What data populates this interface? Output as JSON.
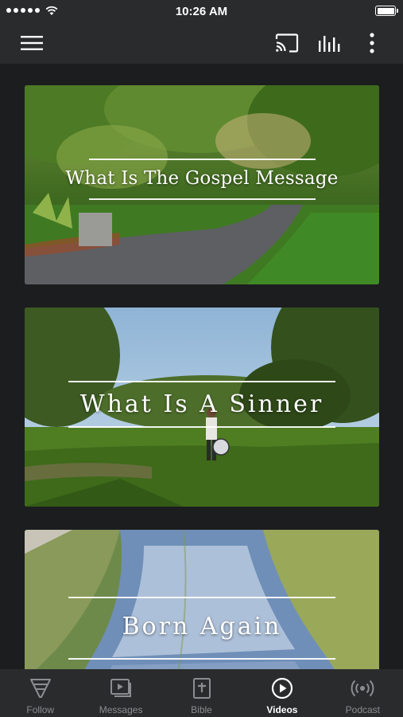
{
  "status_bar": {
    "time": "10:26 AM"
  },
  "app_bar": {
    "icons": [
      "menu-icon",
      "cast-icon",
      "equalizer-icon",
      "more-vertical-icon"
    ]
  },
  "videos": [
    {
      "title": "What Is The Gospel Message",
      "thumbnail": "park-path-trees"
    },
    {
      "title": "What Is A Sinner",
      "thumbnail": "person-walking-in-park"
    },
    {
      "title": "Born Again",
      "thumbnail": "aerial-canal-reeds"
    }
  ],
  "tabs": [
    {
      "label": "Follow",
      "icon": "follow-icon",
      "active": false
    },
    {
      "label": "Messages",
      "icon": "messages-icon",
      "active": false
    },
    {
      "label": "Bible",
      "icon": "bible-icon",
      "active": false
    },
    {
      "label": "Videos",
      "icon": "play-circle-icon",
      "active": true
    },
    {
      "label": "Podcast",
      "icon": "podcast-icon",
      "active": false
    }
  ],
  "colors": {
    "bar_background": "#2a2b2d",
    "page_background": "#1c1d1f",
    "active_tab": "#ffffff",
    "inactive_tab": "#8c8d90"
  }
}
